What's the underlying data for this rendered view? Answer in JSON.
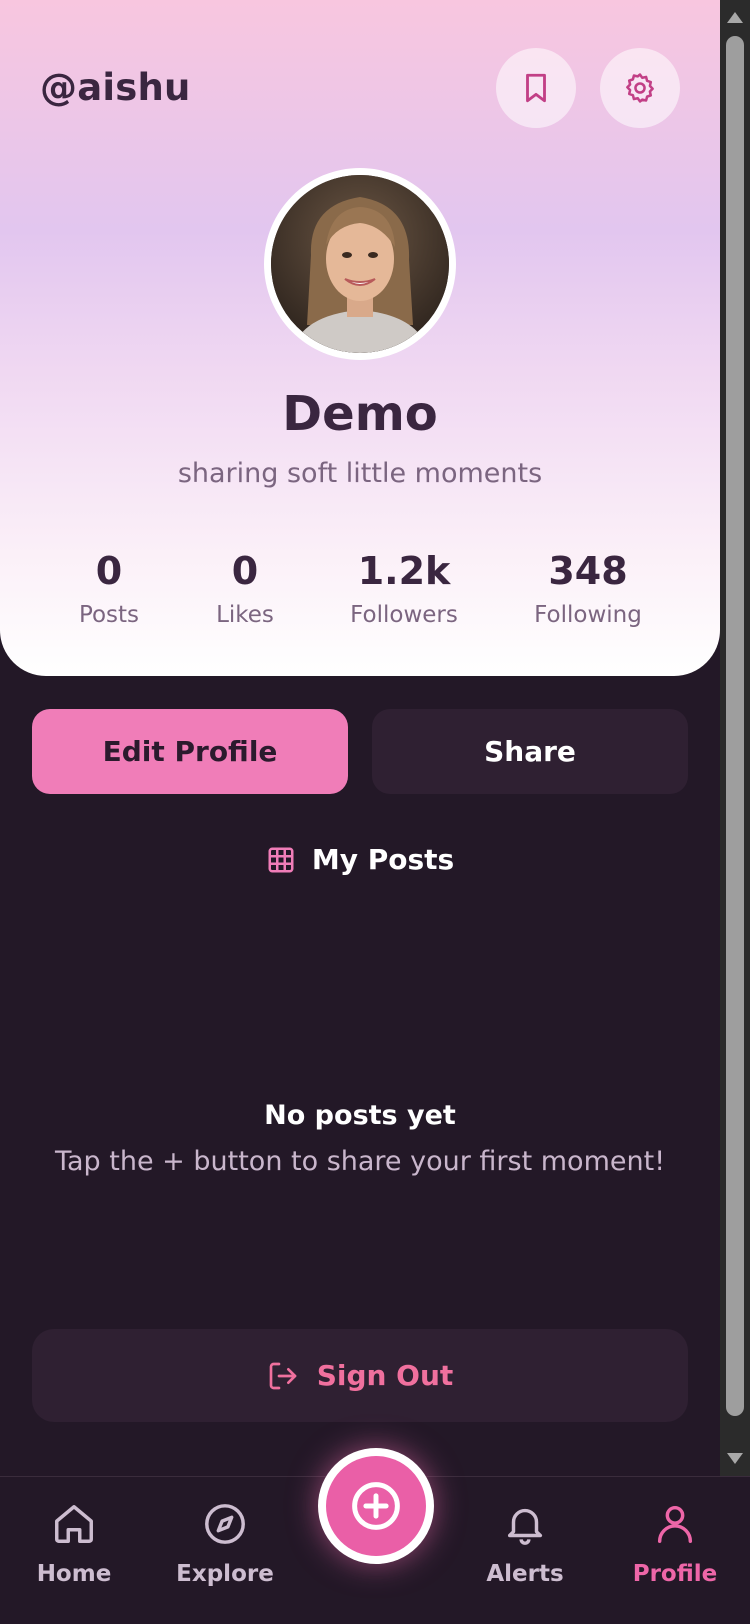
{
  "header": {
    "username": "@aishu",
    "bookmark_icon": "bookmark-icon",
    "settings_icon": "gear-icon"
  },
  "profile": {
    "display_name": "Demo",
    "bio": "sharing soft little moments",
    "avatar": "avatar-photo"
  },
  "stats": [
    {
      "value": "0",
      "label": "Posts"
    },
    {
      "value": "0",
      "label": "Likes"
    },
    {
      "value": "1.2k",
      "label": "Followers"
    },
    {
      "value": "348",
      "label": "Following"
    }
  ],
  "actions": {
    "edit_label": "Edit Profile",
    "share_label": "Share"
  },
  "posts": {
    "section_title": "My Posts",
    "section_icon": "grid-icon",
    "empty_title": "No posts yet",
    "empty_subtitle": "Tap the + button to share your first moment!"
  },
  "signout": {
    "label": "Sign Out",
    "icon": "logout-icon"
  },
  "nav": {
    "items": [
      {
        "label": "Home",
        "icon": "home-icon"
      },
      {
        "label": "Explore",
        "icon": "compass-icon"
      },
      {
        "label": "Alerts",
        "icon": "bell-icon"
      },
      {
        "label": "Profile",
        "icon": "user-icon",
        "active": true
      }
    ],
    "fab_icon": "plus-circle-icon"
  },
  "colors": {
    "accent": "#ea5fa7",
    "background": "#231827",
    "card": "#2f2032",
    "signout_text": "#f0709e"
  }
}
